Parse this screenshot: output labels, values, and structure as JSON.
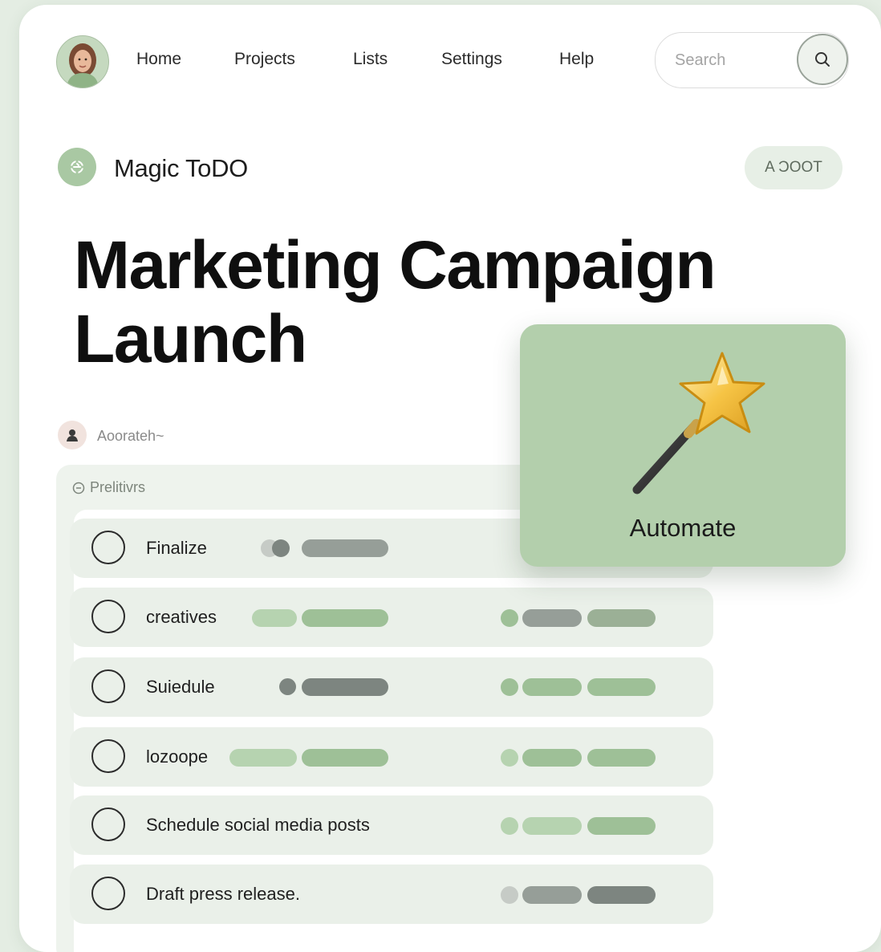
{
  "nav": {
    "links": [
      "Home",
      "Projects",
      "Lists",
      "Settings",
      "Help"
    ],
    "search_placeholder": "Search"
  },
  "brand": {
    "name": "Magic ToDO",
    "badge": "A ƆOOT"
  },
  "page": {
    "title": "Marketing Campaign Launch"
  },
  "assignee": {
    "label": "Aoorateh~"
  },
  "panel": {
    "header": "Prelitivrs"
  },
  "tasks": [
    {
      "label": "Finalize"
    },
    {
      "label": "creatives"
    },
    {
      "label": "Suiedule"
    },
    {
      "label": "lozoope"
    },
    {
      "label": "Schedule social media posts"
    },
    {
      "label": "Draft press release."
    }
  ],
  "automate": {
    "label": "Automate",
    "icon": "magic-wand-star-icon"
  },
  "colors": {
    "background": "#e4ede3",
    "accent_green": "#b3cfac",
    "row_bg": "#eaf0e9",
    "text": "#1f1f1f"
  }
}
